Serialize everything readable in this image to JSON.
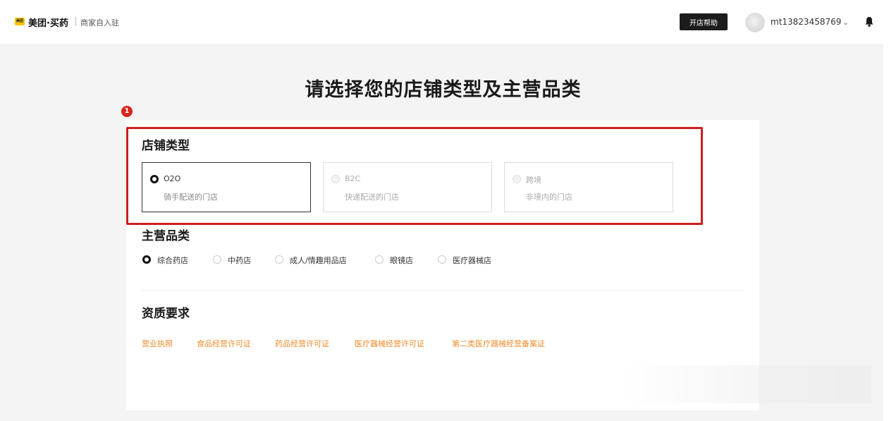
{
  "header": {
    "logo_text": "美团",
    "brand": "美团·买药",
    "subtitle": "商家自入驻",
    "help_label": "开店帮助",
    "username": "mt13823458769",
    "username_chevron": "⌄",
    "icons": {
      "bell": "bell-icon",
      "avatar": "avatar"
    }
  },
  "main": {
    "title": "请选择您的店铺类型及主营品类",
    "step_badge": "1",
    "store_type": {
      "title": "店铺类型",
      "options": [
        {
          "name": "O2O",
          "desc": "骑手配送的门店",
          "state": "selected"
        },
        {
          "name": "B2C",
          "desc": "快递配送的门店",
          "state": "disabled"
        },
        {
          "name": "跨境",
          "desc": "非境内的门店",
          "state": "disabled"
        }
      ]
    },
    "category": {
      "title": "主营品类",
      "options": [
        {
          "label": "综合药店",
          "checked": true
        },
        {
          "label": "中药店",
          "checked": false
        },
        {
          "label": "成人/情趣用品店",
          "checked": false
        },
        {
          "label": "眼镜店",
          "checked": false
        },
        {
          "label": "医疗器械店",
          "checked": false
        }
      ]
    },
    "qualification": {
      "title": "资质要求",
      "items": [
        "营业执照",
        "食品经营许可证",
        "药品经营许可证",
        "医疗器械经营许可证",
        "第二类医疗器械经营备案证"
      ]
    }
  },
  "colors": {
    "highlight": "#cf1e1e",
    "badge": "#d7261d",
    "qualification_link": "#f08c2a",
    "help_button": "#1c1c1c",
    "logo": "#f7c300"
  }
}
